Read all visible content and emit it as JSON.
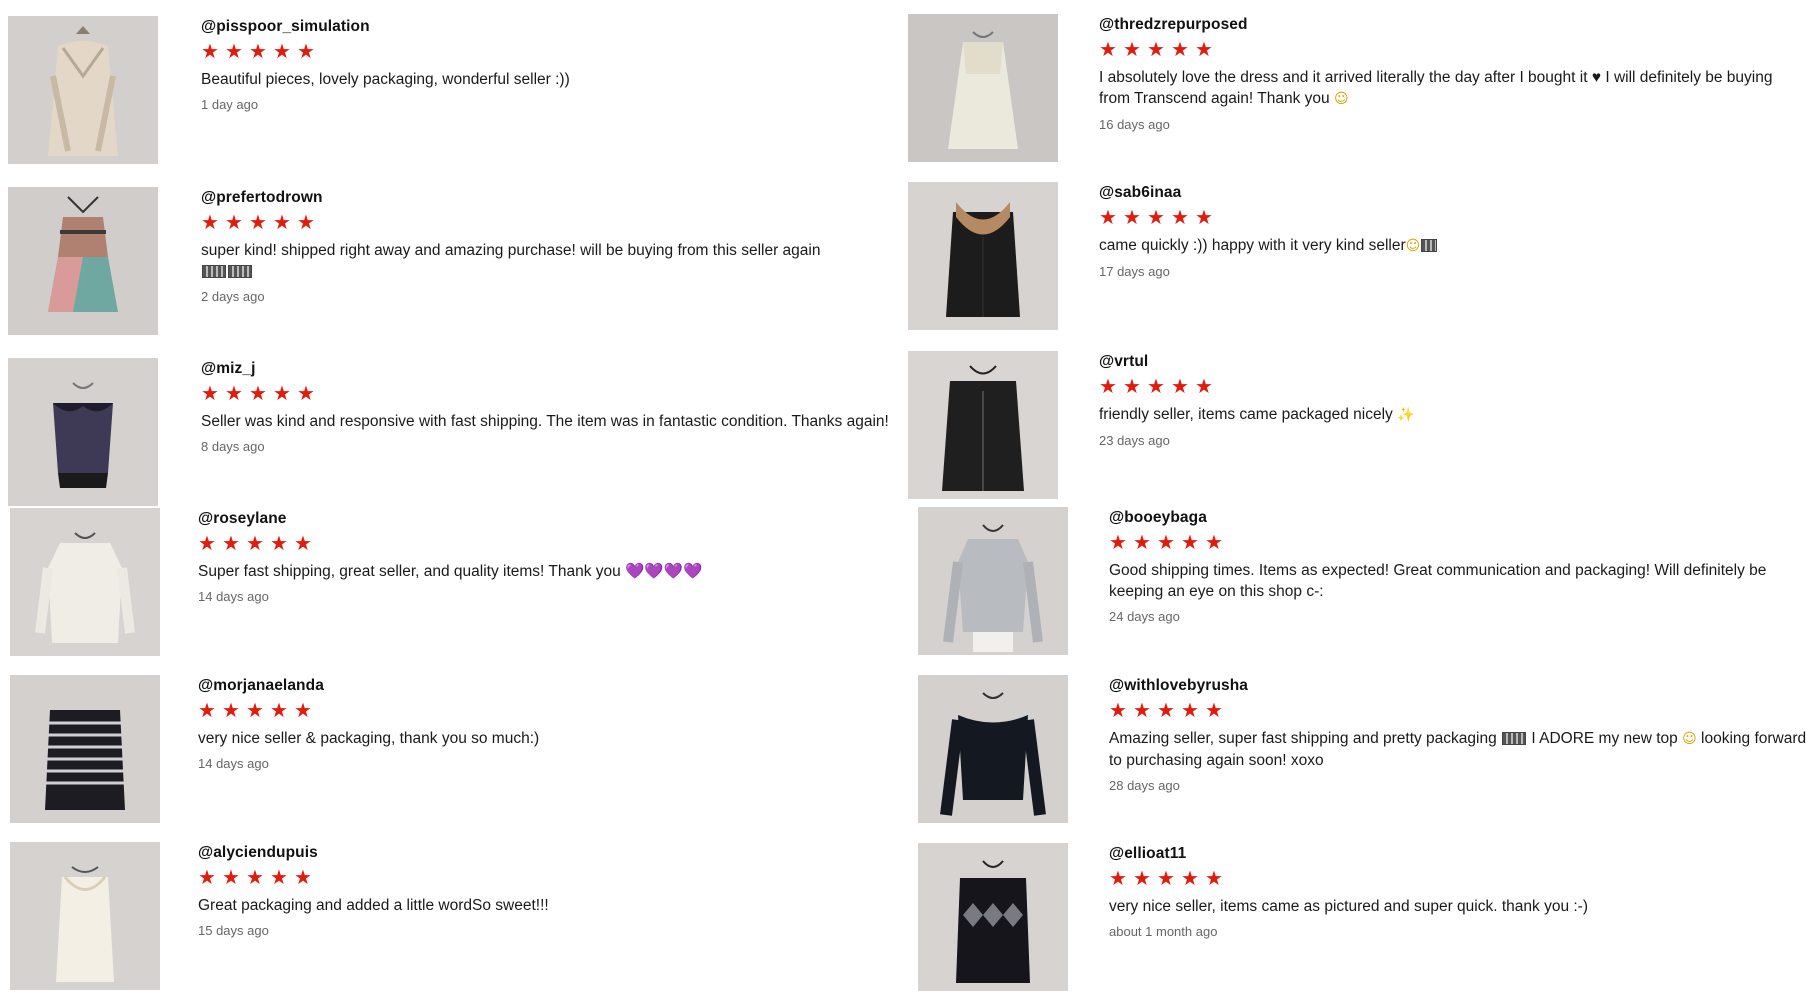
{
  "reviews": [
    {
      "handle": "@pisspoor_simulation",
      "comment": "Beautiful pieces, lovely packaging, wonderful seller :))",
      "date": "1 day ago",
      "item": "lace-cardigan",
      "rating": 5
    },
    {
      "handle": "@prefertodrown",
      "comment": "super kind! shipped right away and amazing purchase! will be buying from this seller again",
      "suffix": "",
      "date": "2 days ago",
      "item": "patchwork-top",
      "rating": 5
    },
    {
      "handle": "@miz_j",
      "comment": "Seller was kind and responsive with fast shipping. The item was in fantastic condition. Thanks again!",
      "date": "8 days ago",
      "item": "corset-top",
      "rating": 5
    },
    {
      "handle": "@roseylane",
      "comment": "Super fast shipping, great seller, and quality items! Thank you",
      "suffix": "💜💜💜💜",
      "date": "14 days ago",
      "item": "white-longsleeve",
      "rating": 5
    },
    {
      "handle": "@morjanaelanda",
      "comment": "very nice seller & packaging, thank you so much:)",
      "date": "14 days ago",
      "item": "striped-top",
      "rating": 5
    },
    {
      "handle": "@alyciendupuis",
      "comment": "Great packaging and added a little wordSo sweet!!!",
      "date": "15 days ago",
      "item": "cream-tank",
      "rating": 5
    },
    {
      "handle": "@thredzrepurposed",
      "comment": "I absolutely love the dress and it arrived literally the day after I bought it ♥ I will definitely be buying from Transcend again! Thank you",
      "suffix": "☺",
      "date": "16 days ago",
      "item": "cream-dress",
      "rating": 5
    },
    {
      "handle": "@sab6inaa",
      "comment": "came quickly :)) happy with it very kind seller",
      "suffix": "☺",
      "date": "17 days ago",
      "item": "fur-collar-cardigan",
      "rating": 5
    },
    {
      "handle": "@vrtul",
      "comment": "friendly seller, items came packaged nicely",
      "suffix": "✨",
      "date": "23 days ago",
      "item": "black-zip-jacket",
      "rating": 5
    },
    {
      "handle": "@booeybaga",
      "comment": "Good shipping times. Items as expected! Great communication and packaging! Will definitely be keeping an eye on this shop c-:",
      "date": "24 days ago",
      "item": "grey-top",
      "rating": 5
    },
    {
      "handle": "@withlovebyrusha",
      "comment_a": "Amazing seller, super fast shipping and pretty packaging",
      "comment_b": "I ADORE my new top",
      "comment_c": "looking forward to purchasing again soon! xoxo",
      "date": "28 days ago",
      "item": "black-offshoulder-top",
      "rating": 5
    },
    {
      "handle": "@ellioat11",
      "comment": "very nice seller, items came as pictured and super quick. thank you :-)",
      "date": "about 1 month ago",
      "item": "argyle-sweater",
      "rating": 5
    }
  ],
  "colors": {
    "star": "#e31b0c",
    "date": "#666666"
  }
}
